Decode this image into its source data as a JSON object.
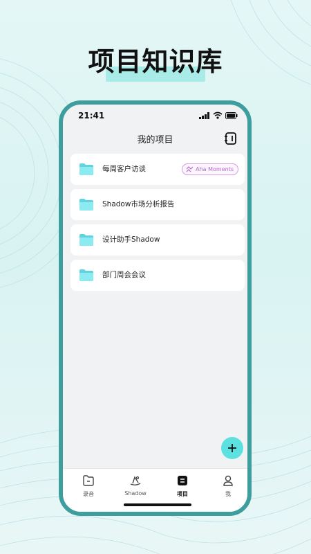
{
  "headline": "项目知识库",
  "colors": {
    "accent": "#5ce0e0",
    "phone_frame": "#3e9e9d",
    "folder": "#6fe0e8",
    "badge_border": "#d69ce0"
  },
  "status_bar": {
    "time": "21:41",
    "icons": [
      "signal-icon",
      "wifi-icon",
      "battery-icon"
    ]
  },
  "nav": {
    "title": "我的项目",
    "action_icon": "new-note-icon"
  },
  "projects": [
    {
      "name": "每周客户访谈",
      "icon": "folder-icon",
      "badge": "Aha Moments",
      "badge_icon": "sparkle-icon"
    },
    {
      "name": "Shadow市场分析报告",
      "icon": "folder-icon"
    },
    {
      "name": "设计助手Shadow",
      "icon": "folder-icon"
    },
    {
      "name": "部门周会会议",
      "icon": "folder-icon"
    }
  ],
  "fab": {
    "icon": "plus-icon"
  },
  "tabbar": {
    "tabs": [
      {
        "label": "录音",
        "icon": "folder-outline-icon",
        "active": false
      },
      {
        "label": "Shadow",
        "icon": "shadow-hat-icon",
        "active": false
      },
      {
        "label": "项目",
        "icon": "list-square-icon",
        "active": true
      },
      {
        "label": "我",
        "icon": "person-icon",
        "active": false
      }
    ]
  }
}
